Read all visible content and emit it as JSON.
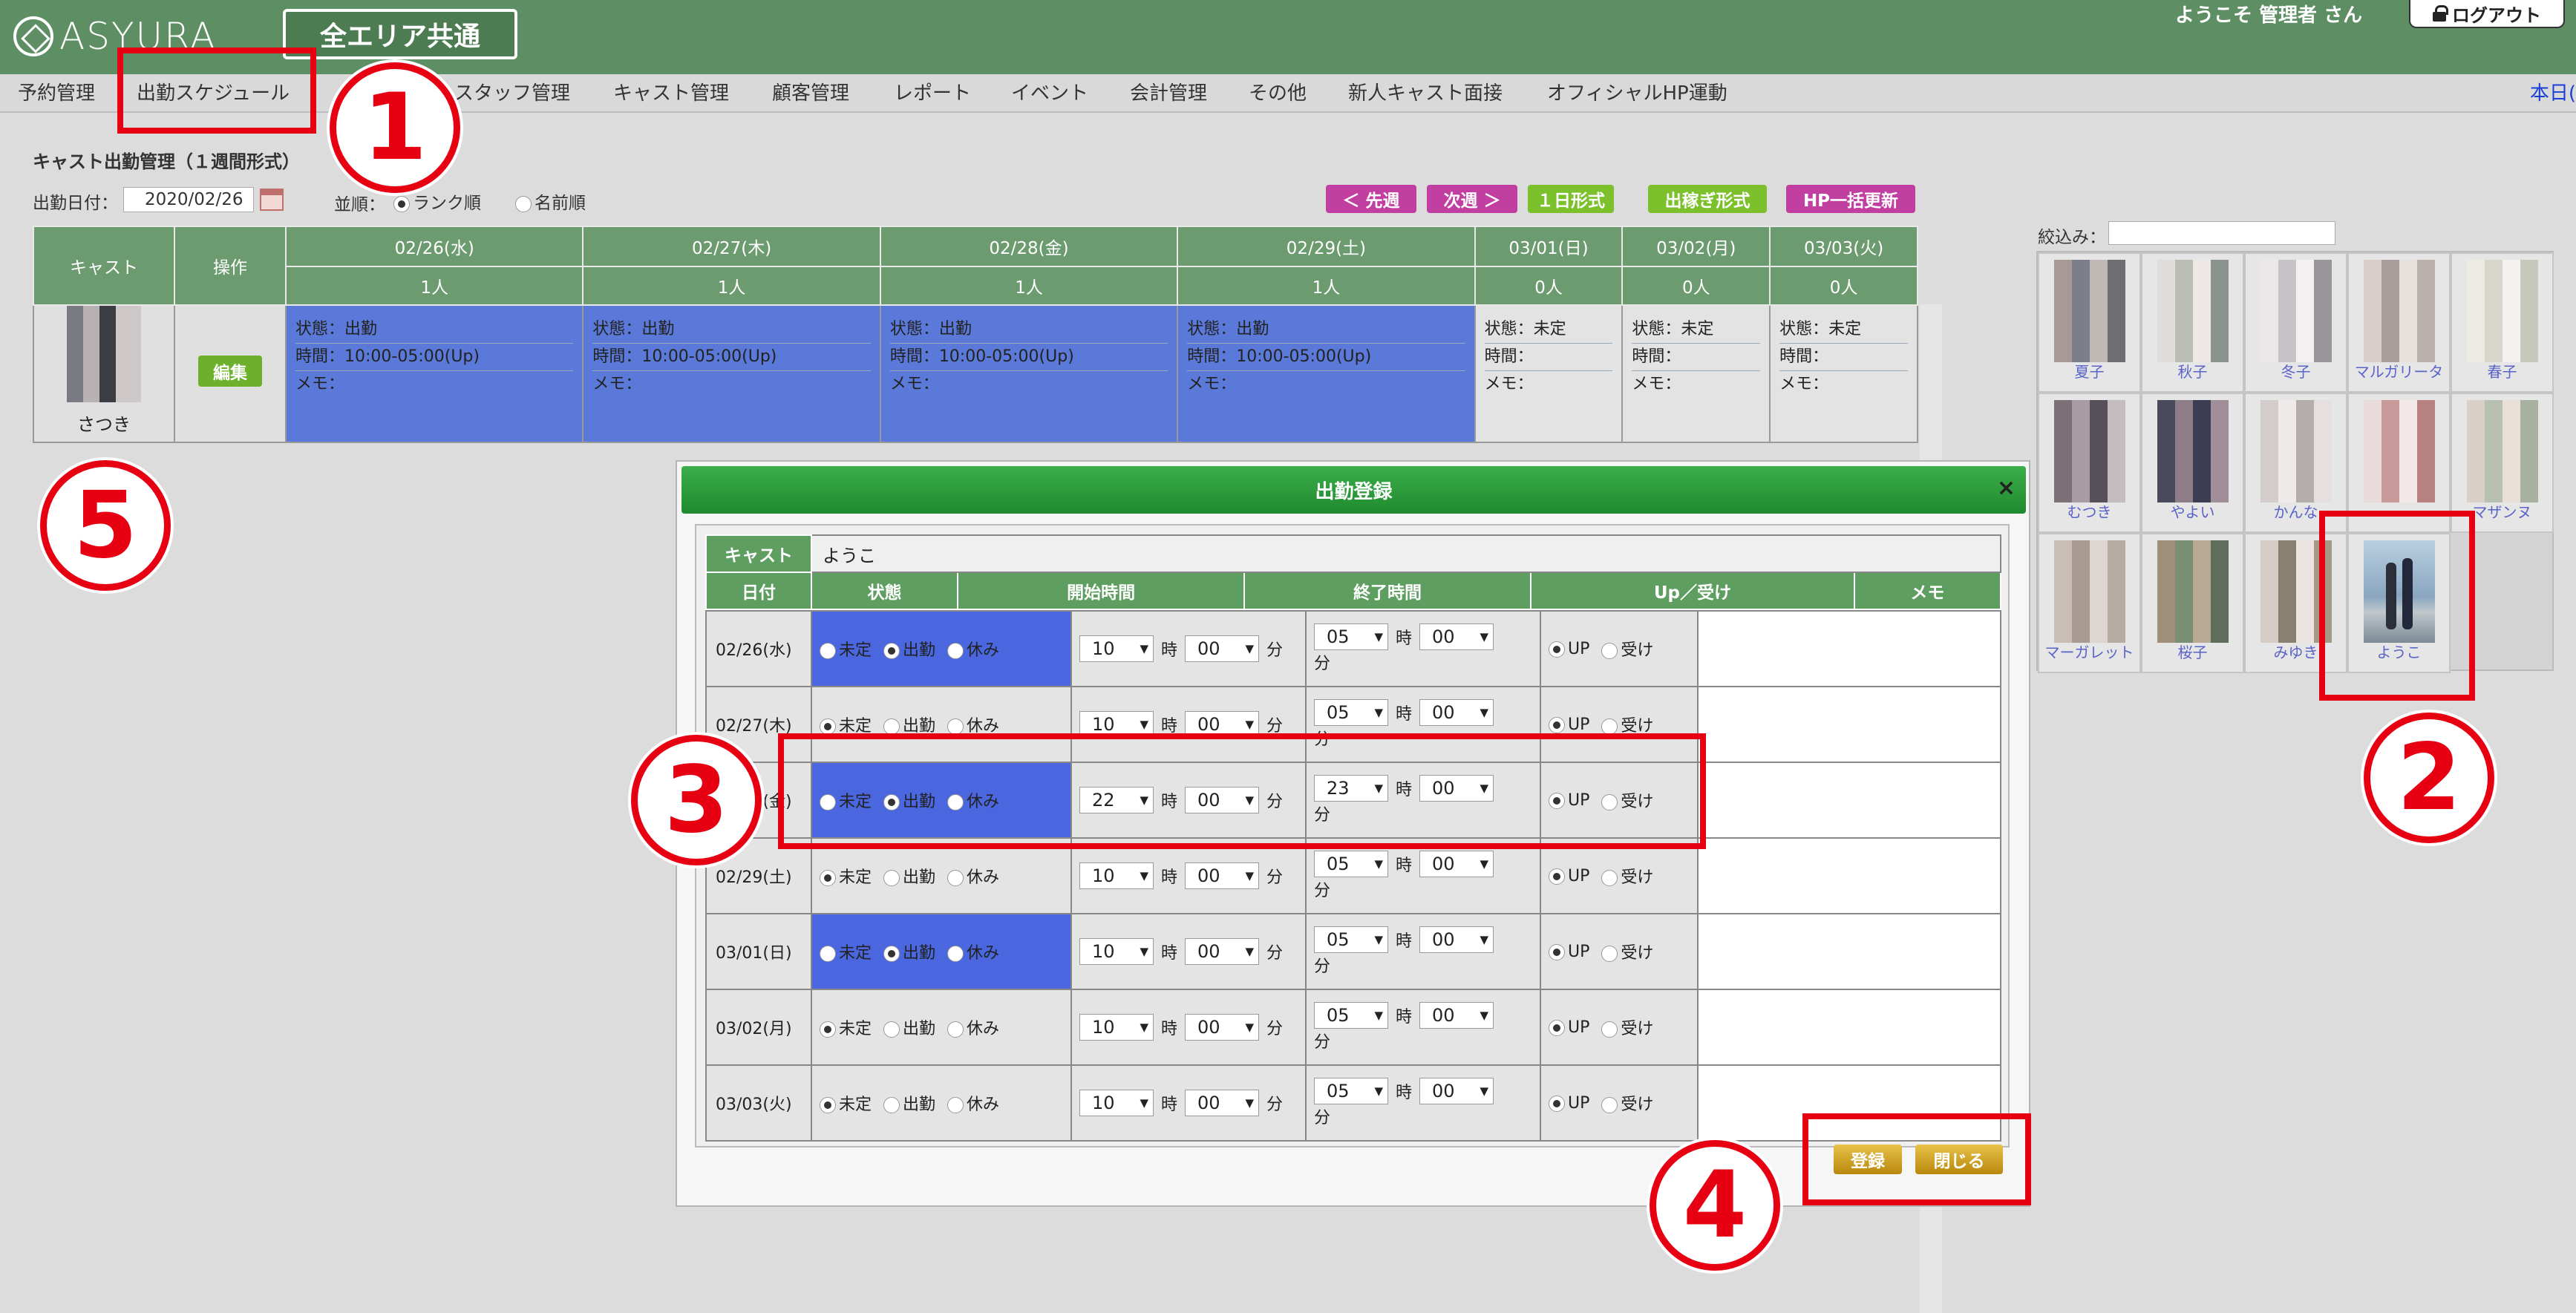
{
  "header": {
    "logo_text": "ASYURA",
    "area_button": "全エリア共通",
    "welcome": "ようこそ 管理者 さん",
    "logout": "ログアウト"
  },
  "menu": {
    "items": [
      "予約管理",
      "出勤スケジュール",
      "ス",
      "スタッフ管理",
      "キャスト管理",
      "顧客管理",
      "レポート",
      "イベント",
      "会計管理",
      "その他",
      "新人キャスト面接",
      "オフィシャルHP運動"
    ],
    "right_link": "本日("
  },
  "page": {
    "title": "キャスト出勤管理（１週間形式）",
    "date_label": "出勤日付：",
    "date_value": "2020/02/26",
    "sort_label": "並順：",
    "sort_rank": "ランク順",
    "sort_name": "名前順",
    "buttons": {
      "prev": "＜ 先週",
      "next": "次週 ＞",
      "day": "１日形式",
      "earn": "出稼ぎ形式",
      "hp": "HP一括更新"
    }
  },
  "schedule": {
    "header_cast": "キャスト",
    "header_action": "操作",
    "days": [
      {
        "date": "02/26(水)",
        "count": "1人"
      },
      {
        "date": "02/27(木)",
        "count": "1人"
      },
      {
        "date": "02/28(金)",
        "count": "1人"
      },
      {
        "date": "02/29(土)",
        "count": "1人"
      },
      {
        "date": "03/01(日)",
        "count": "0人"
      },
      {
        "date": "03/02(月)",
        "count": "0人"
      },
      {
        "date": "03/03(火)",
        "count": "0人"
      }
    ],
    "cast_name": "さつき",
    "edit_button": "編集",
    "cells": [
      {
        "status": "状態：出勤",
        "time": "時間：10:00-05:00(Up)",
        "memo": "メモ：",
        "blue": true
      },
      {
        "status": "状態：出勤",
        "time": "時間：10:00-05:00(Up)",
        "memo": "メモ：",
        "blue": true
      },
      {
        "status": "状態：出勤",
        "time": "時間：10:00-05:00(Up)",
        "memo": "メモ：",
        "blue": true
      },
      {
        "status": "状態：出勤",
        "time": "時間：10:00-05:00(Up)",
        "memo": "メモ：",
        "blue": true
      },
      {
        "status": "状態：未定",
        "time": "時間：",
        "memo": "メモ：",
        "blue": false
      },
      {
        "status": "状態：未定",
        "time": "時間：",
        "memo": "メモ：",
        "blue": false
      },
      {
        "status": "状態：未定",
        "time": "時間：",
        "memo": "メモ：",
        "blue": false
      }
    ]
  },
  "sidebar": {
    "filter_label": "絞込み：",
    "casts": [
      "夏子",
      "秋子",
      "冬子",
      "マルガリータ",
      "春子",
      "むつき",
      "やよい",
      "かんな",
      "",
      "マザンヌ",
      "マーガレット",
      "桜子",
      "みゆき",
      "ようこ"
    ]
  },
  "modal": {
    "title": "出勤登録",
    "close": "×",
    "cast_label": "キャスト",
    "cast_name": "ようこ",
    "col_date": "日付",
    "col_status": "状態",
    "col_start": "開始時間",
    "col_end": "終了時間",
    "col_up": "Up／受け",
    "col_memo": "メモ",
    "opt_undecided": "未定",
    "opt_work": "出勤",
    "opt_off": "休み",
    "unit_hour": "時",
    "unit_min": "分",
    "opt_up": "UP",
    "opt_uke": "受け",
    "rows": [
      {
        "date": "02/26(水)",
        "status": "work",
        "sh": "10",
        "sm": "00",
        "eh": "05",
        "em": "00"
      },
      {
        "date": "02/27(木)",
        "status": "undecided",
        "sh": "10",
        "sm": "00",
        "eh": "05",
        "em": "00"
      },
      {
        "date": "02/28(金)",
        "status": "work",
        "sh": "22",
        "sm": "00",
        "eh": "23",
        "em": "00"
      },
      {
        "date": "02/29(土)",
        "status": "undecided",
        "sh": "10",
        "sm": "00",
        "eh": "05",
        "em": "00"
      },
      {
        "date": "03/01(日)",
        "status": "work",
        "sh": "10",
        "sm": "00",
        "eh": "05",
        "em": "00"
      },
      {
        "date": "03/02(月)",
        "status": "undecided",
        "sh": "10",
        "sm": "00",
        "eh": "05",
        "em": "00"
      },
      {
        "date": "03/03(火)",
        "status": "undecided",
        "sh": "10",
        "sm": "00",
        "eh": "05",
        "em": "00"
      }
    ],
    "register_button": "登録",
    "close_button": "閉じる"
  },
  "annotations": {
    "badges": [
      "1",
      "2",
      "3",
      "4",
      "5"
    ]
  }
}
